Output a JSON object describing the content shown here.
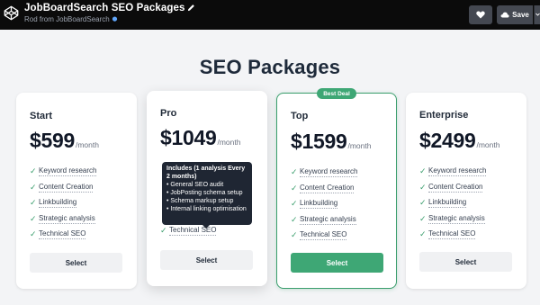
{
  "topbar": {
    "title": "JobBoardSearch SEO Packages",
    "subtitle": "Rod from JobBoardSearch",
    "save_label": "Save",
    "icons": [
      "codepen-logo-icon",
      "pencil-icon",
      "pin-icon",
      "heart-icon",
      "cloud-icon",
      "chevron-down-icon"
    ]
  },
  "heading": "SEO Packages",
  "plans": [
    {
      "name": "Start",
      "price": "$599",
      "period": "/month",
      "features": [
        "Keyword research",
        "Content Creation",
        "Linkbuilding",
        "Strategic analysis",
        "Technical SEO"
      ],
      "button": "Select"
    },
    {
      "name": "Pro",
      "price": "$1049",
      "period": "/month",
      "features": [
        "Technical SEO"
      ],
      "button": "Select"
    },
    {
      "name": "Top",
      "price": "$1599",
      "period": "/month",
      "badge": "Best Deal",
      "features": [
        "Keyword research",
        "Content Creation",
        "Linkbuilding",
        "Strategic analysis",
        "Technical SEO"
      ],
      "button": "Select"
    },
    {
      "name": "Enterprise",
      "price": "$2499",
      "period": "/month",
      "features": [
        "Keyword research",
        "Content Creation",
        "Linkbuilding",
        "Strategic analysis",
        "Technical SEO"
      ],
      "button": "Select"
    }
  ],
  "tooltip": {
    "title": "Includes (1 analysis Every 2 months)",
    "items": [
      "• General SEO audit",
      "• JobPosting schema setup",
      "• Schema markup setup",
      "• Internal linking optimisation"
    ]
  },
  "colors": {
    "accent": "#3ea775",
    "topbar": "#0b0b0b",
    "background": "#f3f4f6",
    "heading": "#1e2a3a"
  }
}
